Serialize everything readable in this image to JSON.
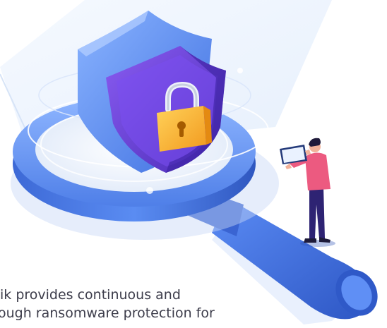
{
  "caption": {
    "line1": "ik provides continuous and",
    "line2": "ough ransomware protection for"
  },
  "icons": [
    "shield-icon",
    "padlock-icon",
    "magnifying-glass-icon",
    "tablet-icon",
    "person-figure"
  ],
  "colors": {
    "shield_back": "#5b8ff2",
    "shield_front": "#6a3fd9",
    "padlock_body": "#f7b733",
    "padlock_shackle": "#e8edf7",
    "magnifier_ring": "#4a78e6",
    "magnifier_handle": "#3f6fe0",
    "person_shirt": "#ec5a80",
    "person_pants": "#2e2373",
    "background_glow": "#eef4fd"
  }
}
